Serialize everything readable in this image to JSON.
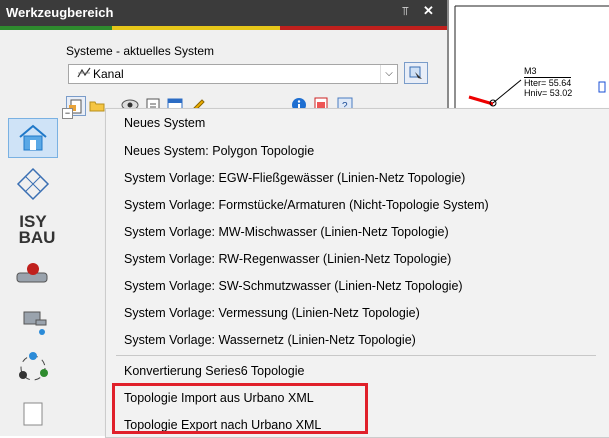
{
  "panel": {
    "title": "Werkzeugbereich",
    "pin_glyph": "4",
    "close_glyph": "×",
    "color_bar": [
      "#2e8b2e",
      "#e6c619",
      "#c0201d"
    ]
  },
  "systems": {
    "label": "Systeme - aktuelles System",
    "current": "Kanal",
    "icon": "kanal-system-icon"
  },
  "drawing": {
    "node_name": "M3",
    "hter": "Hter= 55.64",
    "hniv": "Hniv= 53.02"
  },
  "sidebar": {
    "brand_line1": "ISY",
    "brand_line2": "BAU"
  },
  "menu": {
    "items": [
      "Neues System",
      "Neues System: Polygon Topologie",
      "System Vorlage: EGW-Fließgewässer (Linien-Netz Topologie)",
      "System Vorlage: Formstücke/Armaturen (Nicht-Topologie System)",
      "System Vorlage: MW-Mischwasser (Linien-Netz Topologie)",
      "System Vorlage: RW-Regenwasser (Linien-Netz Topologie)",
      "System Vorlage: SW-Schmutzwasser (Linien-Netz Topologie)",
      "System Vorlage: Vermessung (Linien-Netz Topologie)",
      "System Vorlage: Wassernetz (Linien-Netz Topologie)"
    ],
    "items_after_separator": [
      "Konvertierung Series6 Topologie",
      "Topologie Import aus Urbano XML",
      "Topologie Export nach Urbano XML"
    ]
  },
  "colors": {
    "highlight": "#e0202a",
    "header_bg": "#3b3b3b"
  }
}
